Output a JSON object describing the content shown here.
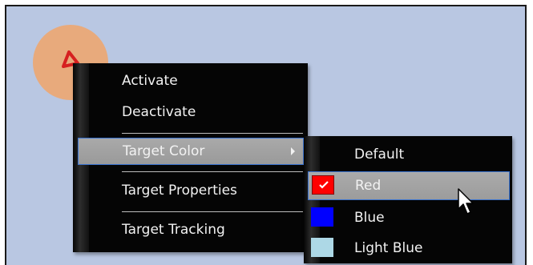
{
  "main_menu": {
    "items": [
      {
        "label": "Activate"
      },
      {
        "label": "Deactivate"
      },
      {
        "label": "Target Color"
      },
      {
        "label": "Target Properties"
      },
      {
        "label": "Target Tracking"
      }
    ],
    "highlighted": "Target Color"
  },
  "color_submenu": {
    "items": [
      {
        "label": "Default",
        "color": null,
        "checked": false
      },
      {
        "label": "Red",
        "color": "#ff0000",
        "checked": true
      },
      {
        "label": "Blue",
        "color": "#0000ff",
        "checked": false
      },
      {
        "label": "Light Blue",
        "color": "#add8e6",
        "checked": false
      }
    ],
    "highlighted": "Red"
  },
  "colors": {
    "background": "#b9c7e2",
    "target_circle": "#e8aa7c",
    "target_marker": "#d62020",
    "menu_background": "#050505",
    "highlight": "#a3a3a3",
    "highlight_border": "#3a73d0"
  },
  "icons": [
    "target-marker-icon",
    "submenu-arrow-icon",
    "checkmark-icon",
    "mouse-pointer-icon"
  ]
}
